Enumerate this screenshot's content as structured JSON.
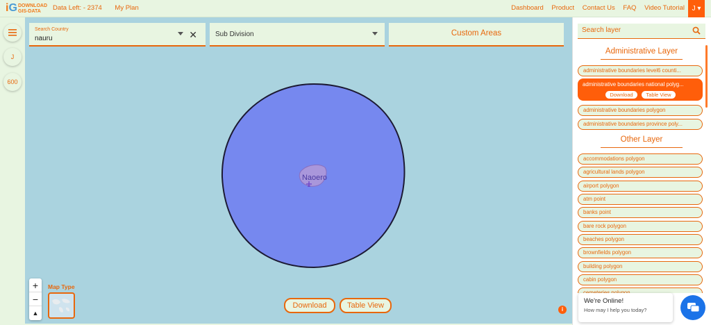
{
  "nav": {
    "logo_top": "DOWNLOAD",
    "logo_bottom": "GIS-DATA",
    "data_left": "Data Left: - 2374",
    "my_plan": "My Plan",
    "links": [
      "Dashboard",
      "Product",
      "Contact Us",
      "FAQ",
      "Video Tutorial"
    ],
    "user_initial": "J ▾"
  },
  "rail": {
    "avatar": "J",
    "count": "600"
  },
  "map": {
    "country_label": "Search Country",
    "country_value": "nauru",
    "subdivision": "Sub Division",
    "custom_areas": "Custom Areas",
    "place_label": "Naoero",
    "map_type_label": "Map Type",
    "download": "Download",
    "table_view": "Table View",
    "info": "i",
    "fill_color": "#7688ef"
  },
  "panel": {
    "search_placeholder": "Search layer",
    "admin_title": "Administrative Layer",
    "admin_layers": [
      "administrative boundaries level6 counti...",
      "administrative boundaries national polyg...",
      "administrative boundaries polygon",
      "administrative boundaries province poly..."
    ],
    "active_download": "Download",
    "active_table_view": "Table View",
    "other_title": "Other Layer",
    "other_layers": [
      "accommodations polygon",
      "agricultural lands polygon",
      "airport polygon",
      "atm point",
      "banks point",
      "bare rock polygon",
      "beaches polygon",
      "brownfields polygon",
      "building polygon",
      "cabin polygon",
      "cemeteries polygon"
    ],
    "chat_title": "We're Online!",
    "chat_sub": "How may I help you today?"
  }
}
